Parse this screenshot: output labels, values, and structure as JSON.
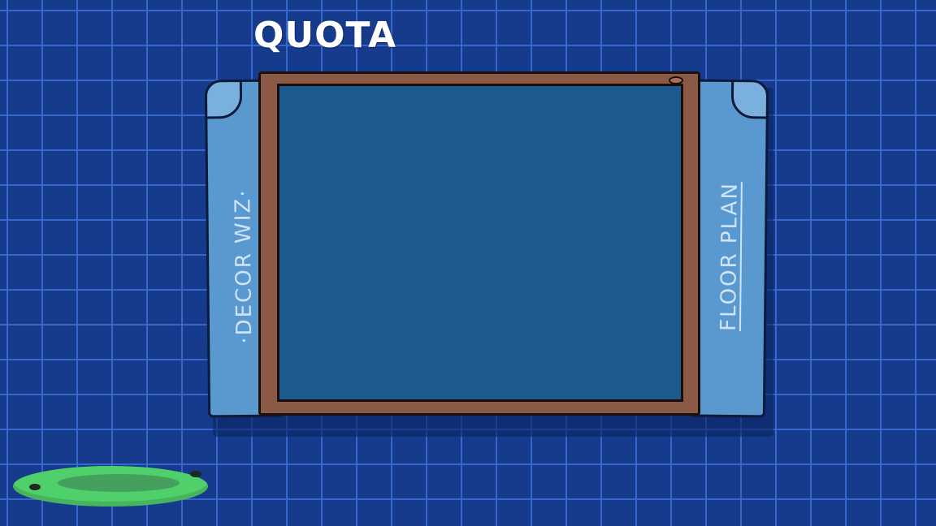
{
  "title": "QUOTA",
  "side_tabs": {
    "left_label": "·DECOR WIZ·",
    "right_label": "FLOOR PLAN"
  },
  "colors": {
    "background": "#163a8c",
    "grid_lines": "#3c6ed7",
    "board": "#1d5b8f",
    "frame_wood": "#8b5a47",
    "side_panel": "#5a98d0",
    "puddle": "#4fd06a"
  }
}
